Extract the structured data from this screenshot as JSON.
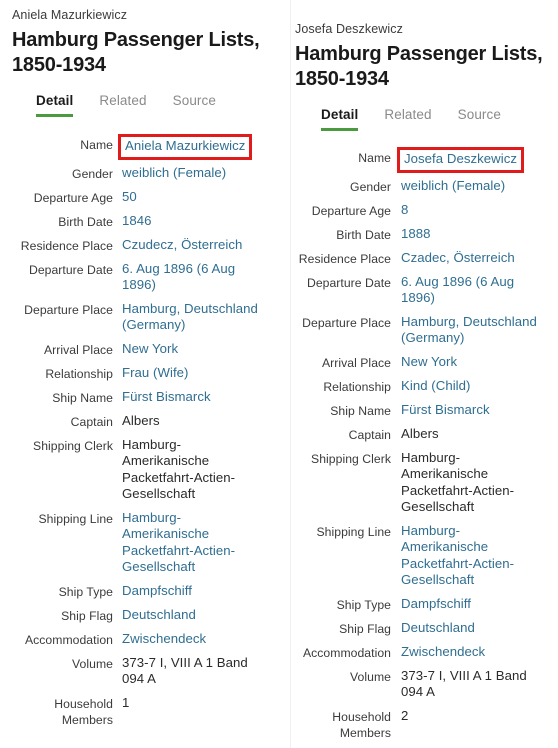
{
  "theme": {
    "link_color": "#2f6e91",
    "text_color": "#2b2b2b",
    "label_color": "#3b3b3b",
    "tab_active_underline": "#4a9b3f",
    "highlight_border": "#e01b1b",
    "divider_color": "#f0f0f0"
  },
  "panels": [
    {
      "record_name": "Aniela Mazurkiewicz",
      "collection_title": "Hamburg Passenger Lists, 1850-1934",
      "tabs": [
        {
          "label": "Detail",
          "active": true
        },
        {
          "label": "Related",
          "active": false
        },
        {
          "label": "Source",
          "active": false
        }
      ],
      "fields": [
        {
          "label": "Name",
          "value": "Aniela Mazurkiewicz",
          "style": "link",
          "highlighted": true
        },
        {
          "label": "Gender",
          "value": "weiblich (Female)",
          "style": "link",
          "highlighted": false
        },
        {
          "label": "Departure Age",
          "value": "50",
          "style": "link",
          "highlighted": false
        },
        {
          "label": "Birth Date",
          "value": "1846",
          "style": "link",
          "highlighted": false
        },
        {
          "label": "Residence Place",
          "value": "Czudecz, Österreich",
          "style": "link",
          "highlighted": false
        },
        {
          "label": "Departure Date",
          "value": "6. Aug 1896 (6 Aug 1896)",
          "style": "link",
          "highlighted": false
        },
        {
          "label": "Departure Place",
          "value": "Hamburg, Deutschland (Germany)",
          "style": "link",
          "highlighted": false
        },
        {
          "label": "Arrival Place",
          "value": "New York",
          "style": "link",
          "highlighted": false
        },
        {
          "label": "Relationship",
          "value": "Frau (Wife)",
          "style": "link",
          "highlighted": false
        },
        {
          "label": "Ship Name",
          "value": "Fürst Bismarck",
          "style": "link",
          "highlighted": false
        },
        {
          "label": "Captain",
          "value": "Albers",
          "style": "plain",
          "highlighted": false
        },
        {
          "label": "Shipping Clerk",
          "value": "Hamburg-Amerikanische Packetfahrt-Actien-Gesellschaft",
          "style": "plain",
          "highlighted": false
        },
        {
          "label": "Shipping Line",
          "value": "Hamburg-Amerikanische Packetfahrt-Actien-Gesellschaft",
          "style": "link",
          "highlighted": false
        },
        {
          "label": "Ship Type",
          "value": "Dampfschiff",
          "style": "link",
          "highlighted": false
        },
        {
          "label": "Ship Flag",
          "value": "Deutschland",
          "style": "link",
          "highlighted": false
        },
        {
          "label": "Accommodation",
          "value": "Zwischendeck",
          "style": "link",
          "highlighted": false
        },
        {
          "label": "Volume",
          "value": "373-7 I, VIII A 1 Band 094 A",
          "style": "plain",
          "highlighted": false
        },
        {
          "label": "Household Members",
          "value": "1",
          "style": "plain",
          "highlighted": false
        }
      ]
    },
    {
      "record_name": "Josefa Deszkewicz",
      "collection_title": "Hamburg Passenger Lists, 1850-1934",
      "tabs": [
        {
          "label": "Detail",
          "active": true
        },
        {
          "label": "Related",
          "active": false
        },
        {
          "label": "Source",
          "active": false
        }
      ],
      "fields": [
        {
          "label": "Name",
          "value": "Josefa Deszkewicz",
          "style": "link",
          "highlighted": true
        },
        {
          "label": "Gender",
          "value": "weiblich (Female)",
          "style": "link",
          "highlighted": false
        },
        {
          "label": "Departure Age",
          "value": "8",
          "style": "link",
          "highlighted": false
        },
        {
          "label": "Birth Date",
          "value": "1888",
          "style": "link",
          "highlighted": false
        },
        {
          "label": "Residence Place",
          "value": "Czadec, Österreich",
          "style": "link",
          "highlighted": false
        },
        {
          "label": "Departure Date",
          "value": "6. Aug 1896 (6 Aug 1896)",
          "style": "link",
          "highlighted": false
        },
        {
          "label": "Departure Place",
          "value": "Hamburg, Deutschland (Germany)",
          "style": "link",
          "highlighted": false
        },
        {
          "label": "Arrival Place",
          "value": "New York",
          "style": "link",
          "highlighted": false
        },
        {
          "label": "Relationship",
          "value": "Kind (Child)",
          "style": "link",
          "highlighted": false
        },
        {
          "label": "Ship Name",
          "value": "Fürst Bismarck",
          "style": "link",
          "highlighted": false
        },
        {
          "label": "Captain",
          "value": "Albers",
          "style": "plain",
          "highlighted": false
        },
        {
          "label": "Shipping Clerk",
          "value": "Hamburg-Amerikanische Packetfahrt-Actien-Gesellschaft",
          "style": "plain",
          "highlighted": false
        },
        {
          "label": "Shipping Line",
          "value": "Hamburg-Amerikanische Packetfahrt-Actien-Gesellschaft",
          "style": "link",
          "highlighted": false
        },
        {
          "label": "Ship Type",
          "value": "Dampfschiff",
          "style": "link",
          "highlighted": false
        },
        {
          "label": "Ship Flag",
          "value": "Deutschland",
          "style": "link",
          "highlighted": false
        },
        {
          "label": "Accommodation",
          "value": "Zwischendeck",
          "style": "link",
          "highlighted": false
        },
        {
          "label": "Volume",
          "value": "373-7 I, VIII A 1 Band 094 A",
          "style": "plain",
          "highlighted": false
        },
        {
          "label": "Household Members",
          "value": "2",
          "style": "plain",
          "highlighted": false
        }
      ]
    }
  ]
}
